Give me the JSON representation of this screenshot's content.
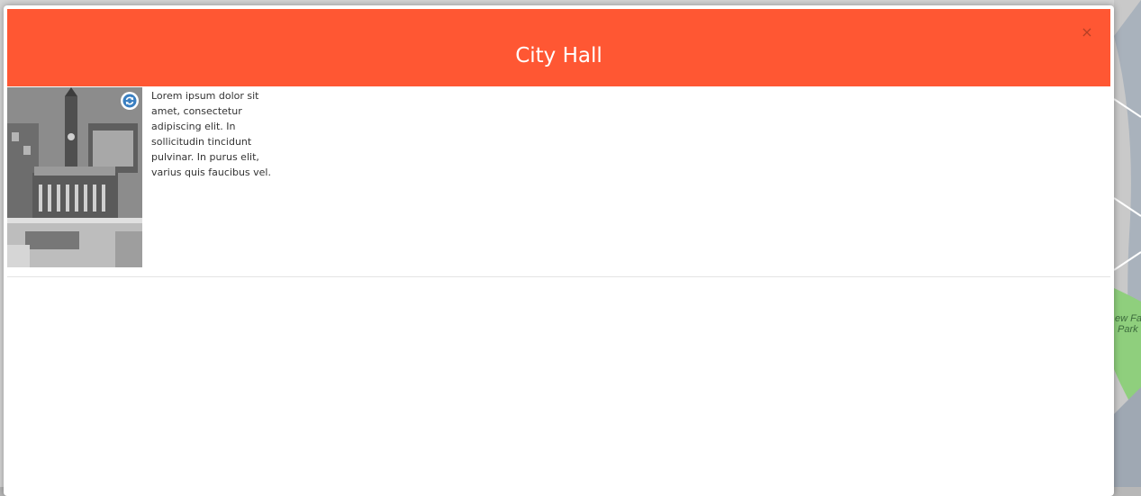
{
  "modal": {
    "title": "City Hall",
    "close_symbol": "×",
    "description": "Lorem ipsum dolor sit amet, consectetur adipiscing elit. In sollicitudin tincidunt pulvinar. In purus elit, varius quis faucibus vel.",
    "photo_icon": "refresh-icon"
  },
  "map": {
    "labels": [
      "ew Fa",
      "Park"
    ]
  },
  "colors": {
    "header": "#ff5733",
    "header_text": "#ffffff",
    "refresh_icon": "#3a7fc1",
    "map_park": "#8fcf7d"
  }
}
